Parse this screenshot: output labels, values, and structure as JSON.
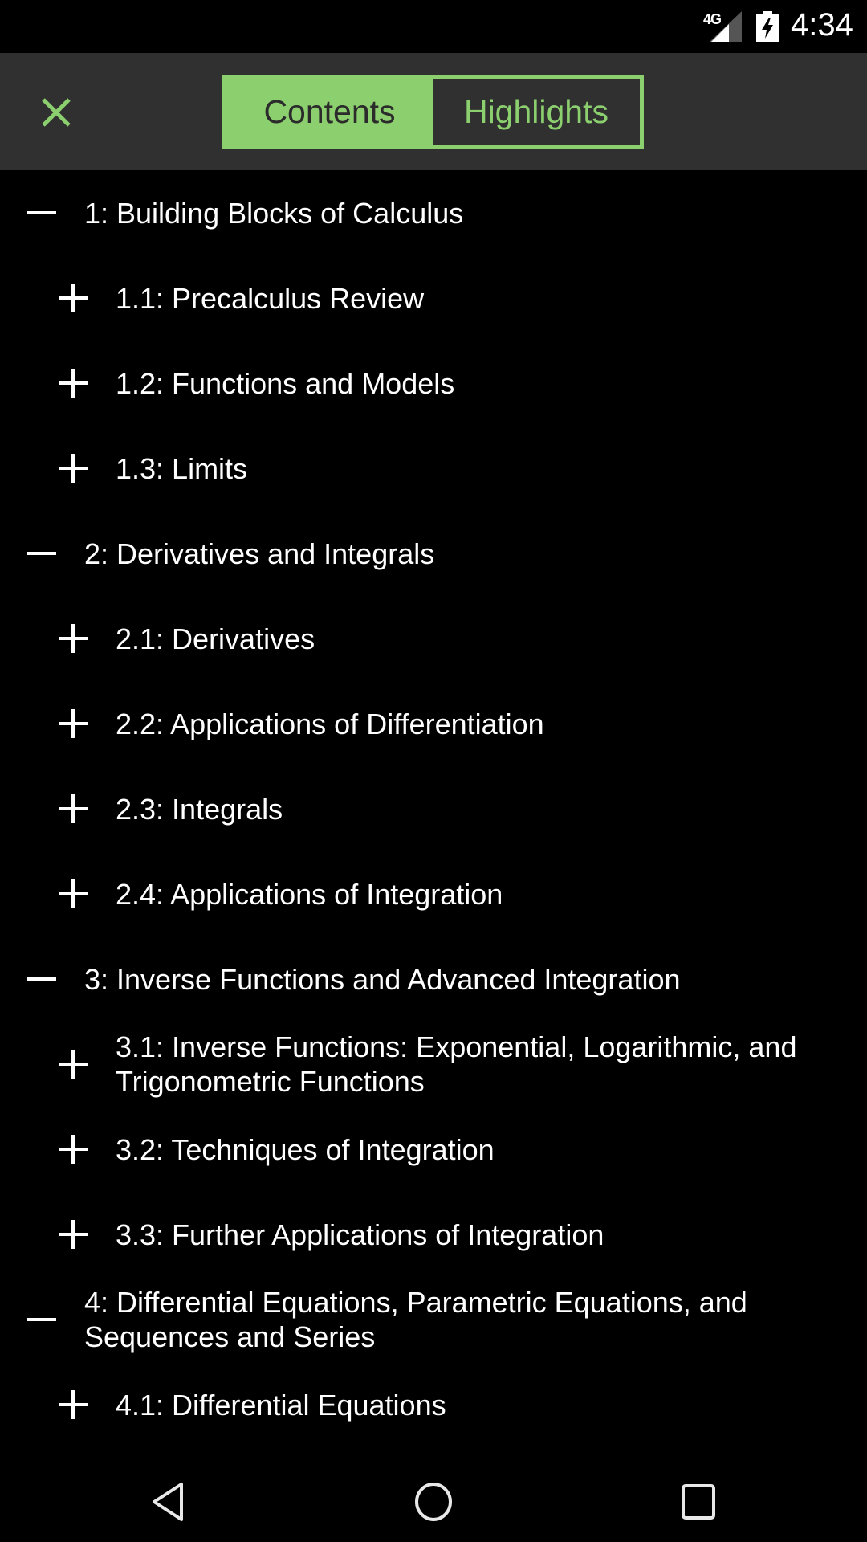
{
  "status_bar": {
    "network": "4G",
    "time": "4:34",
    "icons": [
      "signal-icon",
      "battery-charging-icon"
    ]
  },
  "toolbar": {
    "close_icon": "close-icon",
    "tabs": [
      {
        "label": "Contents",
        "active": true
      },
      {
        "label": "Highlights",
        "active": false
      }
    ]
  },
  "colors": {
    "accent": "#8ccf6f",
    "toolbar_bg": "#303030",
    "background": "#000000",
    "text": "#ffffff"
  },
  "toc": {
    "items": [
      {
        "level": 1,
        "state": "expanded",
        "icon": "minus-icon",
        "label": "1: Building Blocks of Calculus"
      },
      {
        "level": 2,
        "state": "collapsed",
        "icon": "plus-icon",
        "label": "1.1: Precalculus Review"
      },
      {
        "level": 2,
        "state": "collapsed",
        "icon": "plus-icon",
        "label": "1.2: Functions and Models"
      },
      {
        "level": 2,
        "state": "collapsed",
        "icon": "plus-icon",
        "label": "1.3: Limits"
      },
      {
        "level": 1,
        "state": "expanded",
        "icon": "minus-icon",
        "label": "2: Derivatives and Integrals"
      },
      {
        "level": 2,
        "state": "collapsed",
        "icon": "plus-icon",
        "label": "2.1: Derivatives"
      },
      {
        "level": 2,
        "state": "collapsed",
        "icon": "plus-icon",
        "label": "2.2: Applications of Differentiation"
      },
      {
        "level": 2,
        "state": "collapsed",
        "icon": "plus-icon",
        "label": "2.3: Integrals"
      },
      {
        "level": 2,
        "state": "collapsed",
        "icon": "plus-icon",
        "label": "2.4: Applications of Integration"
      },
      {
        "level": 1,
        "state": "expanded",
        "icon": "minus-icon",
        "label": "3: Inverse Functions and Advanced Integration"
      },
      {
        "level": 2,
        "state": "collapsed",
        "icon": "plus-icon",
        "label": "3.1: Inverse Functions: Exponential, Logarithmic, and Trigonometric Functions"
      },
      {
        "level": 2,
        "state": "collapsed",
        "icon": "plus-icon",
        "label": "3.2: Techniques of Integration"
      },
      {
        "level": 2,
        "state": "collapsed",
        "icon": "plus-icon",
        "label": "3.3: Further Applications of Integration"
      },
      {
        "level": 1,
        "state": "expanded",
        "icon": "minus-icon",
        "label": "4: Differential Equations, Parametric Equations, and Sequences and Series"
      },
      {
        "level": 2,
        "state": "collapsed",
        "icon": "plus-icon",
        "label": "4.1: Differential Equations"
      }
    ]
  },
  "nav_bar": {
    "buttons": [
      {
        "name": "back",
        "icon": "back-triangle-icon"
      },
      {
        "name": "home",
        "icon": "home-circle-icon"
      },
      {
        "name": "recents",
        "icon": "recents-square-icon"
      }
    ]
  }
}
